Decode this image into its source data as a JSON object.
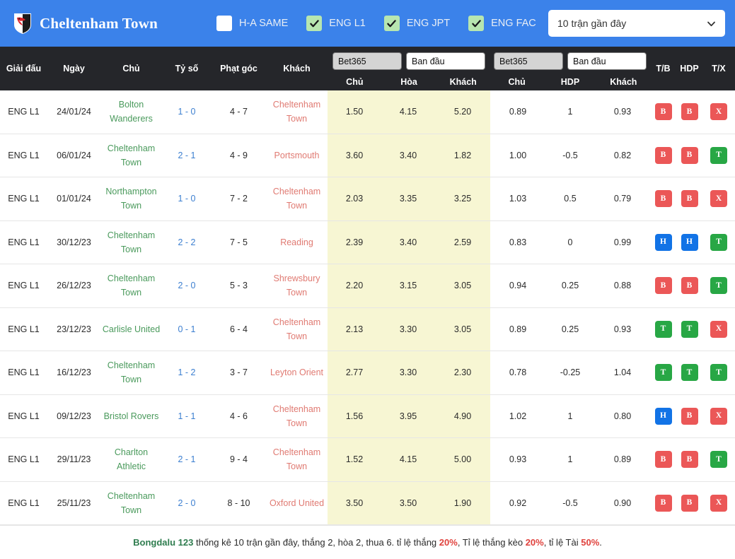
{
  "header": {
    "team_name": "Cheltenham Town",
    "logo_icon": "club-crest-icon",
    "filters": [
      {
        "label": "H-A SAME",
        "checked": false,
        "icon": "checkbox-icon"
      },
      {
        "label": "ENG L1",
        "checked": true,
        "icon": "checkbox-checked-icon"
      },
      {
        "label": "ENG JPT",
        "checked": true,
        "icon": "checkbox-checked-icon"
      },
      {
        "label": "ENG FAC",
        "checked": true,
        "icon": "checkbox-checked-icon"
      }
    ],
    "range_select": {
      "value": "10 trận gần đây",
      "caret_icon": "chevron-down-icon"
    },
    "accent_color": "#3b82ea"
  },
  "table": {
    "columns": {
      "league": "Giải đấu",
      "date": "Ngày",
      "home": "Chủ",
      "score": "Tỷ số",
      "corner": "Phạt góc",
      "away": "Khách",
      "tb": "T/B",
      "hdp": "HDP",
      "tx": "T/X"
    },
    "odds_group": {
      "bookmaker_select": {
        "value": "Bet365"
      },
      "period_select": {
        "value": "Ban đầu"
      },
      "sub_home": "Chủ",
      "sub_draw": "Hòa",
      "sub_away": "Khách"
    },
    "asian_group": {
      "bookmaker_select": {
        "value": "Bet365"
      },
      "period_select": {
        "value": "Ban đầu"
      },
      "sub_home": "Chủ",
      "sub_hdp": "HDP",
      "sub_away": "Khách"
    },
    "rows": [
      {
        "league": "ENG L1",
        "date": "24/01/24",
        "home": "Bolton Wanderers",
        "score": "1 - 0",
        "corner": "4 - 7",
        "away": "Cheltenham Town",
        "o1": "1.50",
        "ox": "4.15",
        "o2": "5.20",
        "ah_home": "0.89",
        "ah_hdp": "1",
        "ah_away": "0.93",
        "tb": {
          "text": "B",
          "kind": "b"
        },
        "hdp": {
          "text": "B",
          "kind": "b"
        },
        "tx": {
          "text": "X",
          "kind": "x"
        }
      },
      {
        "league": "ENG L1",
        "date": "06/01/24",
        "home": "Cheltenham Town",
        "score": "2 - 1",
        "corner": "4 - 9",
        "away": "Portsmouth",
        "o1": "3.60",
        "ox": "3.40",
        "o2": "1.82",
        "ah_home": "1.00",
        "ah_hdp": "-0.5",
        "ah_away": "0.82",
        "tb": {
          "text": "B",
          "kind": "b"
        },
        "hdp": {
          "text": "B",
          "kind": "b"
        },
        "tx": {
          "text": "T",
          "kind": "t"
        }
      },
      {
        "league": "ENG L1",
        "date": "01/01/24",
        "home": "Northampton Town",
        "score": "1 - 0",
        "corner": "7 - 2",
        "away": "Cheltenham Town",
        "o1": "2.03",
        "ox": "3.35",
        "o2": "3.25",
        "ah_home": "1.03",
        "ah_hdp": "0.5",
        "ah_away": "0.79",
        "tb": {
          "text": "B",
          "kind": "b"
        },
        "hdp": {
          "text": "B",
          "kind": "b"
        },
        "tx": {
          "text": "X",
          "kind": "x"
        }
      },
      {
        "league": "ENG L1",
        "date": "30/12/23",
        "home": "Cheltenham Town",
        "score": "2 - 2",
        "corner": "7 - 5",
        "away": "Reading",
        "o1": "2.39",
        "ox": "3.40",
        "o2": "2.59",
        "ah_home": "0.83",
        "ah_hdp": "0",
        "ah_away": "0.99",
        "tb": {
          "text": "H",
          "kind": "h"
        },
        "hdp": {
          "text": "H",
          "kind": "h"
        },
        "tx": {
          "text": "T",
          "kind": "t"
        }
      },
      {
        "league": "ENG L1",
        "date": "26/12/23",
        "home": "Cheltenham Town",
        "score": "2 - 0",
        "corner": "5 - 3",
        "away": "Shrewsbury Town",
        "o1": "2.20",
        "ox": "3.15",
        "o2": "3.05",
        "ah_home": "0.94",
        "ah_hdp": "0.25",
        "ah_away": "0.88",
        "tb": {
          "text": "B",
          "kind": "b"
        },
        "hdp": {
          "text": "B",
          "kind": "b"
        },
        "tx": {
          "text": "T",
          "kind": "t"
        }
      },
      {
        "league": "ENG L1",
        "date": "23/12/23",
        "home": "Carlisle United",
        "score": "0 - 1",
        "corner": "6 - 4",
        "away": "Cheltenham Town",
        "o1": "2.13",
        "ox": "3.30",
        "o2": "3.05",
        "ah_home": "0.89",
        "ah_hdp": "0.25",
        "ah_away": "0.93",
        "tb": {
          "text": "T",
          "kind": "t"
        },
        "hdp": {
          "text": "T",
          "kind": "t"
        },
        "tx": {
          "text": "X",
          "kind": "x"
        }
      },
      {
        "league": "ENG L1",
        "date": "16/12/23",
        "home": "Cheltenham Town",
        "score": "1 - 2",
        "corner": "3 - 7",
        "away": "Leyton Orient",
        "o1": "2.77",
        "ox": "3.30",
        "o2": "2.30",
        "ah_home": "0.78",
        "ah_hdp": "-0.25",
        "ah_away": "1.04",
        "tb": {
          "text": "T",
          "kind": "t"
        },
        "hdp": {
          "text": "T",
          "kind": "t"
        },
        "tx": {
          "text": "T",
          "kind": "t"
        }
      },
      {
        "league": "ENG L1",
        "date": "09/12/23",
        "home": "Bristol Rovers",
        "score": "1 - 1",
        "corner": "4 - 6",
        "away": "Cheltenham Town",
        "o1": "1.56",
        "ox": "3.95",
        "o2": "4.90",
        "ah_home": "1.02",
        "ah_hdp": "1",
        "ah_away": "0.80",
        "tb": {
          "text": "H",
          "kind": "h"
        },
        "hdp": {
          "text": "B",
          "kind": "b"
        },
        "tx": {
          "text": "X",
          "kind": "x"
        }
      },
      {
        "league": "ENG L1",
        "date": "29/11/23",
        "home": "Charlton Athletic",
        "score": "2 - 1",
        "corner": "9 - 4",
        "away": "Cheltenham Town",
        "o1": "1.52",
        "ox": "4.15",
        "o2": "5.00",
        "ah_home": "0.93",
        "ah_hdp": "1",
        "ah_away": "0.89",
        "tb": {
          "text": "B",
          "kind": "b"
        },
        "hdp": {
          "text": "B",
          "kind": "b"
        },
        "tx": {
          "text": "T",
          "kind": "t"
        }
      },
      {
        "league": "ENG L1",
        "date": "25/11/23",
        "home": "Cheltenham Town",
        "score": "2 - 0",
        "corner": "8 - 10",
        "away": "Oxford United",
        "o1": "3.50",
        "ox": "3.50",
        "o2": "1.90",
        "ah_home": "0.92",
        "ah_hdp": "-0.5",
        "ah_away": "0.90",
        "tb": {
          "text": "B",
          "kind": "b"
        },
        "hdp": {
          "text": "B",
          "kind": "b"
        },
        "tx": {
          "text": "X",
          "kind": "x"
        }
      }
    ]
  },
  "footer": {
    "site": "Bongdalu 123",
    "text1": " thống kê 10 trận gần đây, thắng 2, hòa 2, thua 6. tỉ lệ thắng ",
    "win_pct": "20%",
    "text2": ", Tỉ lệ thắng kèo ",
    "hdp_pct": "20%",
    "text3": ", tỉ lệ Tài ",
    "over_pct": "50%",
    "text4": "."
  }
}
